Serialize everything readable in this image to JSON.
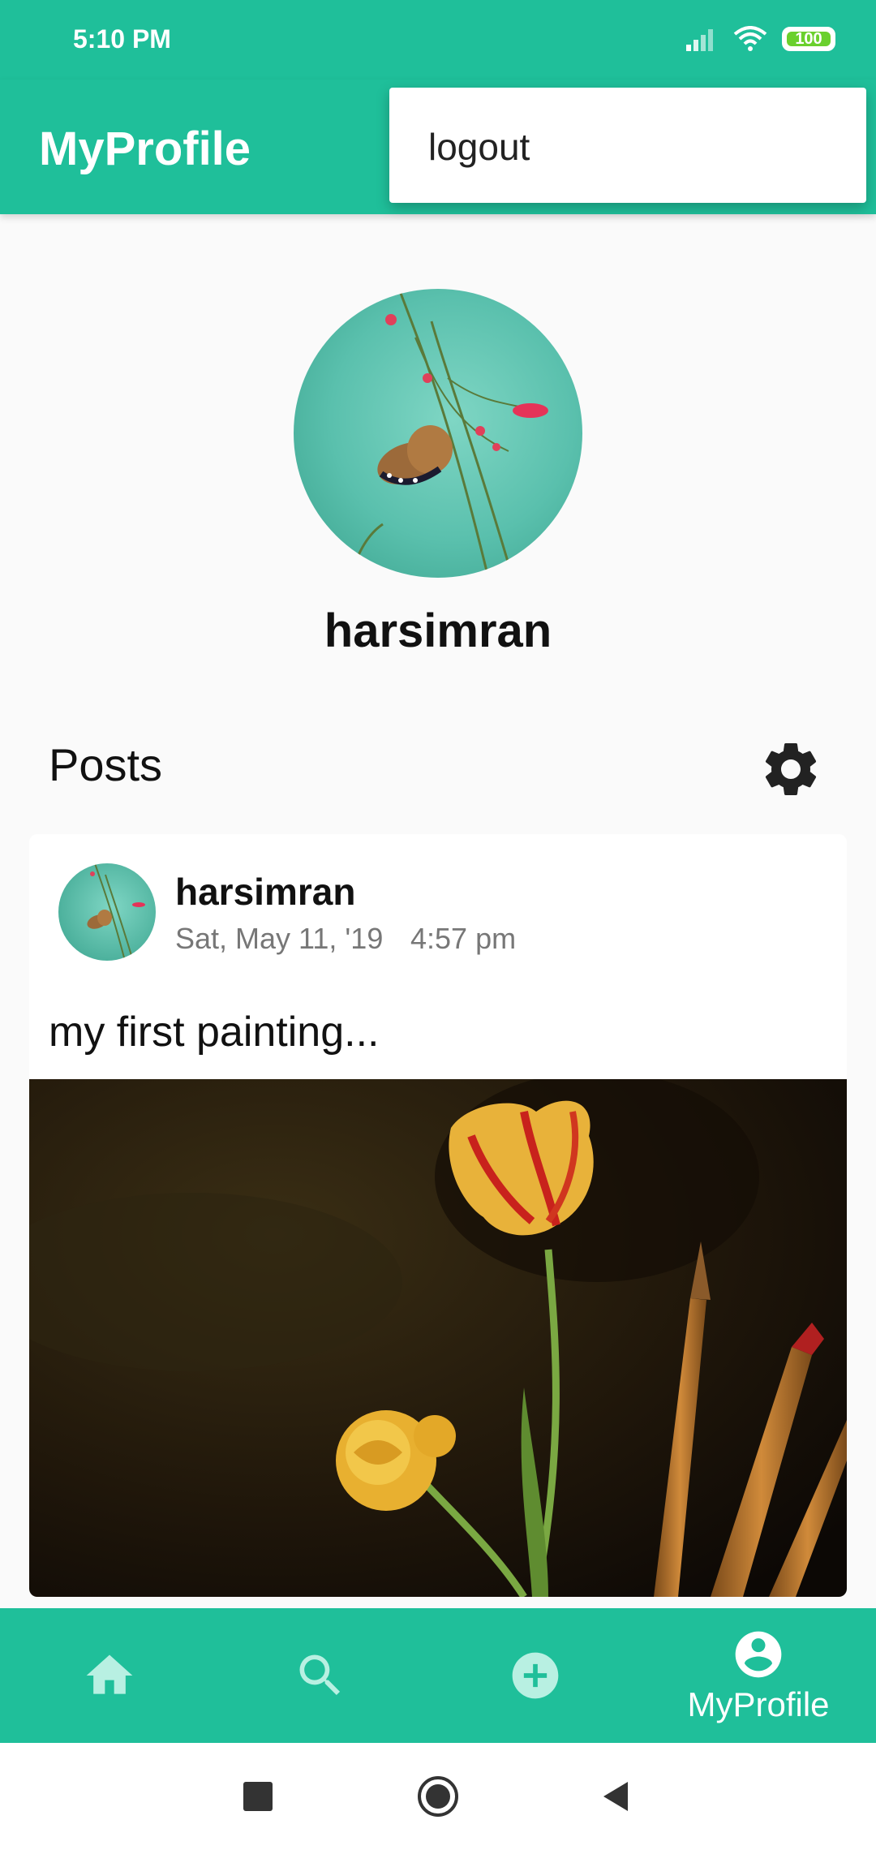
{
  "status_bar": {
    "time": "5:10 PM",
    "battery": "100",
    "icons": [
      "signal-icon",
      "wifi-icon",
      "battery-icon"
    ]
  },
  "app_bar": {
    "title": "MyProfile"
  },
  "overflow_menu": {
    "items": [
      {
        "label": "logout"
      }
    ]
  },
  "profile": {
    "username": "harsimran"
  },
  "posts_section": {
    "title": "Posts"
  },
  "posts": [
    {
      "author": "harsimran",
      "date": "Sat, May 11, '19",
      "time": "4:57 pm",
      "text": "my first painting..."
    }
  ],
  "bottom_nav": {
    "items": [
      {
        "icon": "home-icon"
      },
      {
        "icon": "search-icon"
      },
      {
        "icon": "add-circle-icon"
      },
      {
        "icon": "account-circle-icon",
        "label": "MyProfile"
      }
    ]
  },
  "colors": {
    "primary": "#1fbf9a",
    "background": "#fafafa",
    "battery": "#6ad02d"
  }
}
